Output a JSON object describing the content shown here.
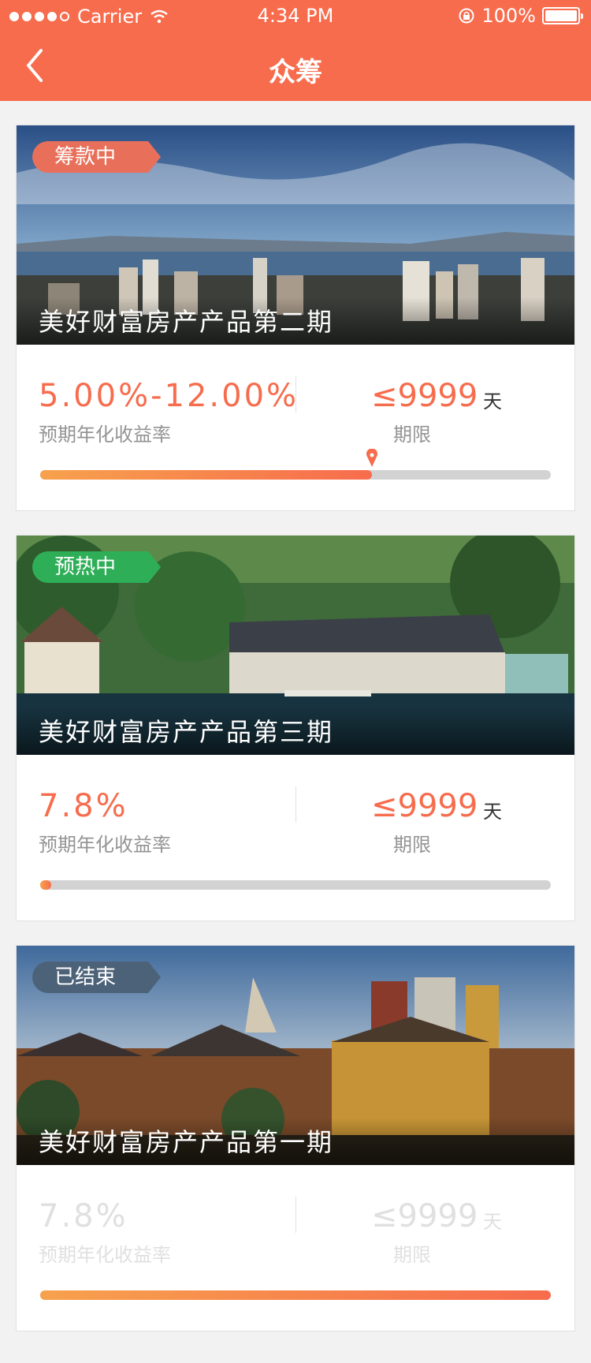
{
  "status_bar": {
    "carrier": "Carrier",
    "time": "4:34 PM",
    "battery": "100%"
  },
  "nav": {
    "title": "众筹"
  },
  "projects": [
    {
      "badge": "筹款中",
      "name": "美好财富房产产品第二期",
      "rate": "5.00%-12.00%",
      "rate_label": "预期年化收益率",
      "term": "≤9999",
      "term_unit": "天",
      "term_label": "期限",
      "progress": 0.65
    },
    {
      "badge": "预热中",
      "name": "美好财富房产产品第三期",
      "rate": "7.8%",
      "rate_label": "预期年化收益率",
      "term": "≤9999",
      "term_unit": "天",
      "term_label": "期限",
      "progress": 0.02
    },
    {
      "badge": "已结束",
      "name": "美好财富房产产品第一期",
      "rate": "7.8%",
      "rate_label": "预期年化收益率",
      "term": "≤9999",
      "term_unit": "天",
      "term_label": "期限",
      "progress": 1.0
    }
  ],
  "colors": {
    "primary": "#f76c4d",
    "gradient_start": "#f7a14d",
    "track": "#d2d2d2",
    "label": "#949494",
    "unit": "#333333",
    "ended": "#e0e0e0",
    "divider": "#e1e1e1"
  }
}
